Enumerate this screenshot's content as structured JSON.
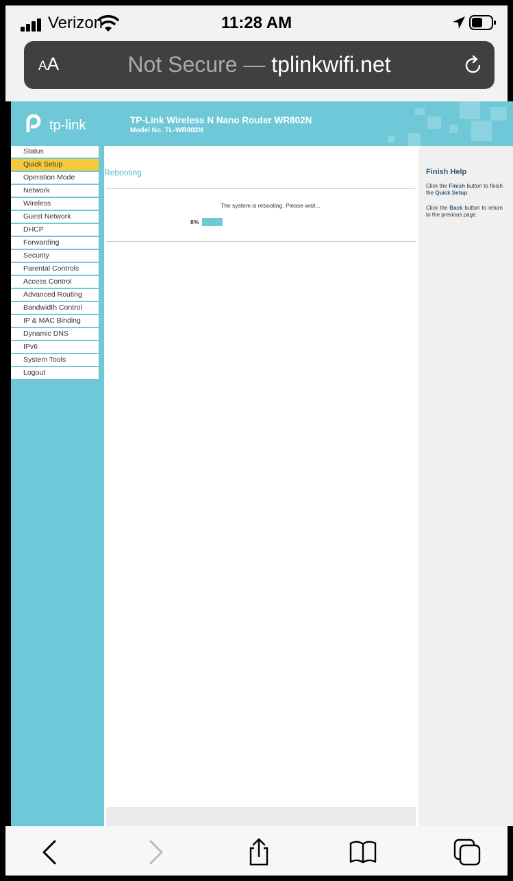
{
  "status_bar": {
    "carrier": "Verizon",
    "time": "11:28 AM"
  },
  "url_bar": {
    "aa_label": "A",
    "aa_label_big": "A",
    "not_secure": "Not Secure",
    "separator": " — ",
    "domain": "tplinkwifi.net"
  },
  "header": {
    "logo_text": "tp-link",
    "title": "TP-Link Wireless N Nano Router WR802N",
    "model": "Model No. TL-WR802N"
  },
  "menu": {
    "items": [
      "Status",
      "Quick Setup",
      "Operation Mode",
      "Network",
      "Wireless",
      "Guest Network",
      "DHCP",
      "Forwarding",
      "Security",
      "Parental Controls",
      "Access Control",
      "Advanced Routing",
      "Bandwidth Control",
      "IP & MAC Binding",
      "Dynamic DNS",
      "IPv6",
      "System Tools",
      "Logout"
    ],
    "active": "Quick Setup"
  },
  "main": {
    "heading": "Rebooting",
    "message": "The system is rebooting. Please wait...",
    "progress_label": "8%",
    "progress_fraction": 0.08
  },
  "help": {
    "title": "Finish Help",
    "p1_a": "Click the ",
    "p1_b": "Finish",
    "p1_c": " button to finish the ",
    "p1_d": "Quick Setup",
    "p1_e": ".",
    "p2_a": "Click the ",
    "p2_b": "Back",
    "p2_c": " button to return to the previous page."
  },
  "colors": {
    "brand_teal": "#6fc8d7",
    "active_menu": "#f6c93c",
    "help_title": "#2e5a7a"
  },
  "icons": {
    "toolbar": [
      "back-chevron-icon",
      "forward-chevron-icon",
      "share-icon",
      "bookmarks-icon",
      "tabs-icon"
    ]
  }
}
